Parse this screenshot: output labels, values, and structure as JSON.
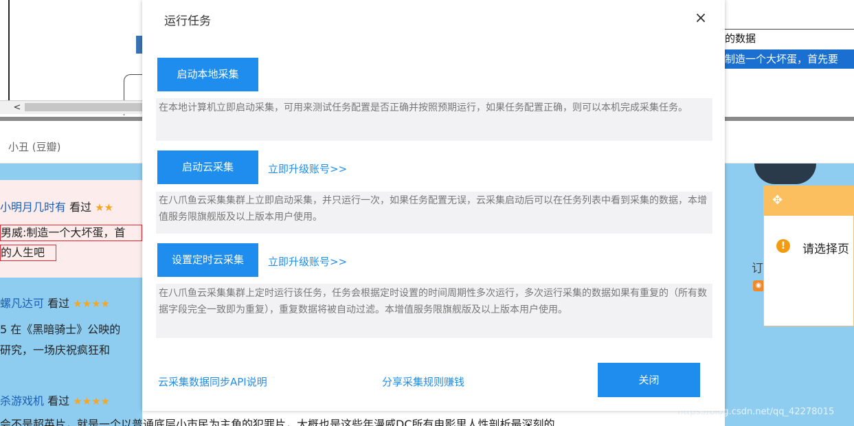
{
  "background": {
    "top_right_line1": "的数据",
    "top_right_line2": "制造一个大坏蛋，首先要",
    "scroll_arrow": "<",
    "user_name": "小丑 (豆瓣)",
    "reviews": [
      {
        "name": "小明月几时有",
        "seen": "看过",
        "stars": "★★",
        "lines": [
          "男威:制造一个大坏蛋，首",
          "的人生吧"
        ]
      },
      {
        "name": "螺凡达可",
        "seen": "看过",
        "stars": "★★★★",
        "lines": [
          "5 在《黑暗骑士》公映的",
          "研究，一场庆祝疯狂和"
        ]
      },
      {
        "name": "杀游戏机",
        "seen": "看过",
        "stars": "★★★★",
        "lines": [
          "会不是超英片，就是一个以普通底层小市民为主角的犯罪片，大概也是这些年漫威DC所有电影里人性剖析最深刻的"
        ]
      }
    ],
    "notice_text": "请选择页",
    "side_char": "订",
    "watermark": "https://blog.csdn.net/qq_42278015"
  },
  "dialog": {
    "title": "运行任务",
    "close_symbol": "×",
    "local": {
      "button": "启动本地采集",
      "desc": "在本地计算机立即启动采集，可用来测试任务配置是否正确并按照预期运行，如果任务配置正确，则可以本机完成采集任务。"
    },
    "cloud": {
      "button": "启动云采集",
      "upgrade": "立即升级账号>>",
      "desc": "在八爪鱼云采集集群上立即启动采集，并只运行一次，如果任务配置无误，云采集启动后可以在任务列表中看到采集的数据，本增值服务限旗舰版及以上版本用户使用。"
    },
    "scheduled": {
      "button": "设置定时云采集",
      "upgrade": "立即升级账号>>",
      "desc": "在八爪鱼云采集集群上定时运行该任务，任务会根据定时设置的时间周期性多次运行，多次运行采集的数据如果有重复的（所有数据字段完全一致即为重复），重复数据将被自动过滤。本增值服务限旗舰版及以上版本用户使用。"
    },
    "footer": {
      "api_link": "云采集数据同步API说明",
      "share_link": "分享采集规则赚钱",
      "close_button": "关闭"
    }
  },
  "colors": {
    "primary": "#1f8ded",
    "desc_bg": "#f2f2f4",
    "page_blue": "#8fcdf0",
    "notice_head": "#fbbf5f"
  }
}
